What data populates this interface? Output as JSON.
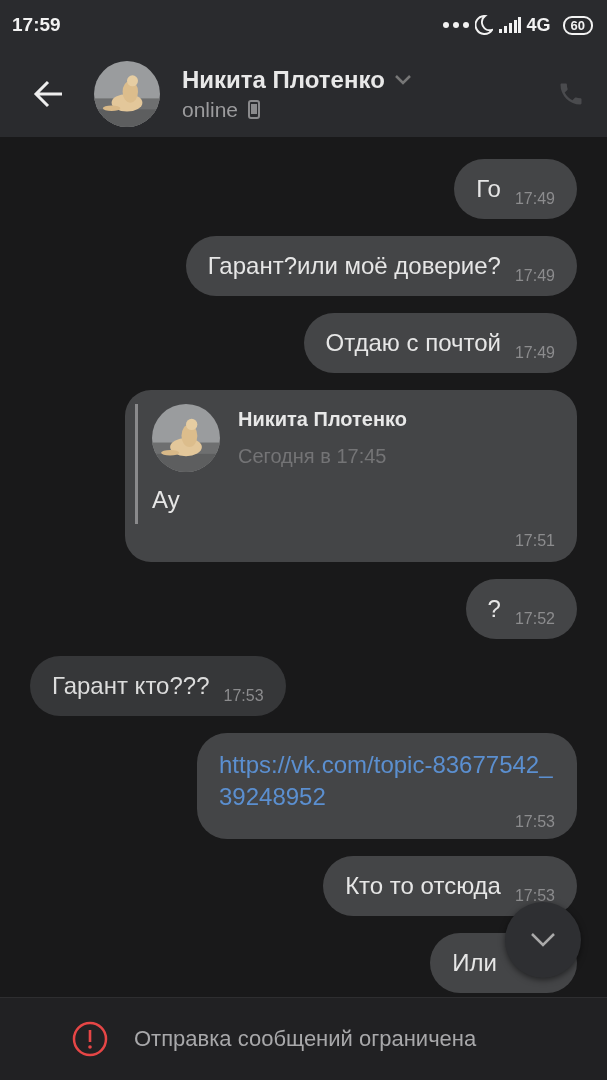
{
  "status_bar": {
    "time": "17:59",
    "network": "4G",
    "battery": "60"
  },
  "header": {
    "name": "Никита Плотенко",
    "status": "online"
  },
  "messages": [
    {
      "kind": "text",
      "outgoing": true,
      "text": "Го",
      "time": "17:49"
    },
    {
      "kind": "text",
      "outgoing": true,
      "text": "Гарант?или моё доверие?",
      "time": "17:49"
    },
    {
      "kind": "text",
      "outgoing": true,
      "text": "Отдаю с почтой",
      "time": "17:49"
    },
    {
      "kind": "forward",
      "outgoing": true,
      "author": "Никита Плотенко",
      "date": "Сегодня в 17:45",
      "text": "Ау",
      "time": "17:51"
    },
    {
      "kind": "text",
      "outgoing": true,
      "text": "?",
      "time": "17:52"
    },
    {
      "kind": "text",
      "outgoing": false,
      "text": "Гарант кто???",
      "time": "17:53"
    },
    {
      "kind": "link",
      "outgoing": true,
      "text": "https://vk.com/topic-83677542_39248952",
      "time": "17:53"
    },
    {
      "kind": "text",
      "outgoing": true,
      "text": "Кто то отсюда",
      "time": "17:53"
    },
    {
      "kind": "text",
      "outgoing": true,
      "text": "Или"
    }
  ],
  "notice": "Отправка сообщений ограничена"
}
